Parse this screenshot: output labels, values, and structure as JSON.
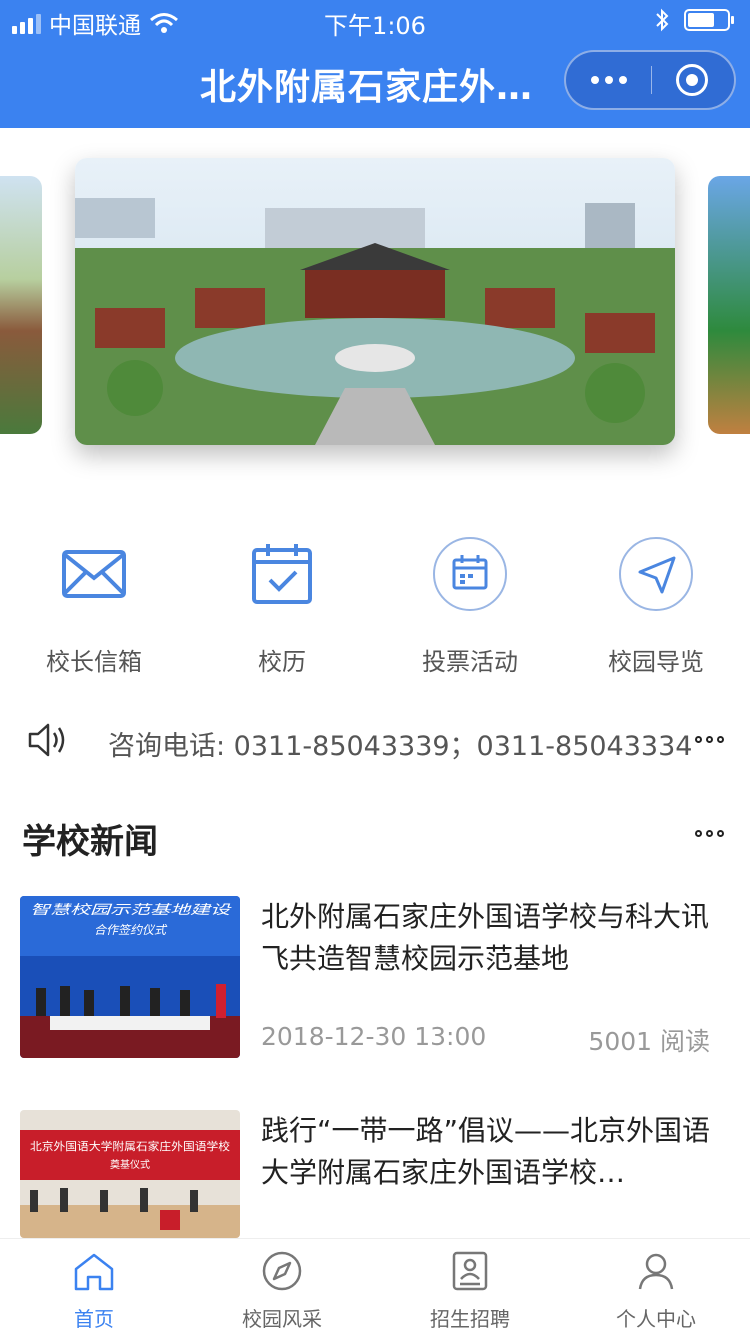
{
  "status_bar": {
    "carrier": "中国联通",
    "time": "下午1:06"
  },
  "nav": {
    "title": "北外附属石家庄外…"
  },
  "quick_links": [
    {
      "label": "校长信箱",
      "icon": "mail-icon"
    },
    {
      "label": "校历",
      "icon": "calendar-check-icon"
    },
    {
      "label": "投票活动",
      "icon": "calendar-icon"
    },
    {
      "label": "校园导览",
      "icon": "navigation-icon"
    }
  ],
  "notice": {
    "text": "咨询电话: 0311-85043339；0311-85043334"
  },
  "news": {
    "section_title": "学校新闻",
    "items": [
      {
        "title": "北外附属石家庄外国语学校与科大讯飞共造智慧校园示范基地",
        "date": "2018-12-30 13:00",
        "reads": "5001 阅读",
        "thumb_caption": "智慧校园示范基地建设 合作签约仪式"
      },
      {
        "title": "践行“一带一路”倡议——北京外国语大学附属石家庄外国语学校…",
        "thumb_caption": "北京外国语大学附属石家庄外国语学校 奠基仪式"
      }
    ]
  },
  "tabbar": [
    {
      "label": "首页",
      "icon": "home-icon",
      "active": true
    },
    {
      "label": "校园风采",
      "icon": "compass-icon",
      "active": false
    },
    {
      "label": "招生招聘",
      "icon": "id-card-icon",
      "active": false
    },
    {
      "label": "个人中心",
      "icon": "user-icon",
      "active": false
    }
  ],
  "colors": {
    "brand": "#3b82f0",
    "icon_blue": "#4a86e0",
    "text_gray": "#999999"
  }
}
